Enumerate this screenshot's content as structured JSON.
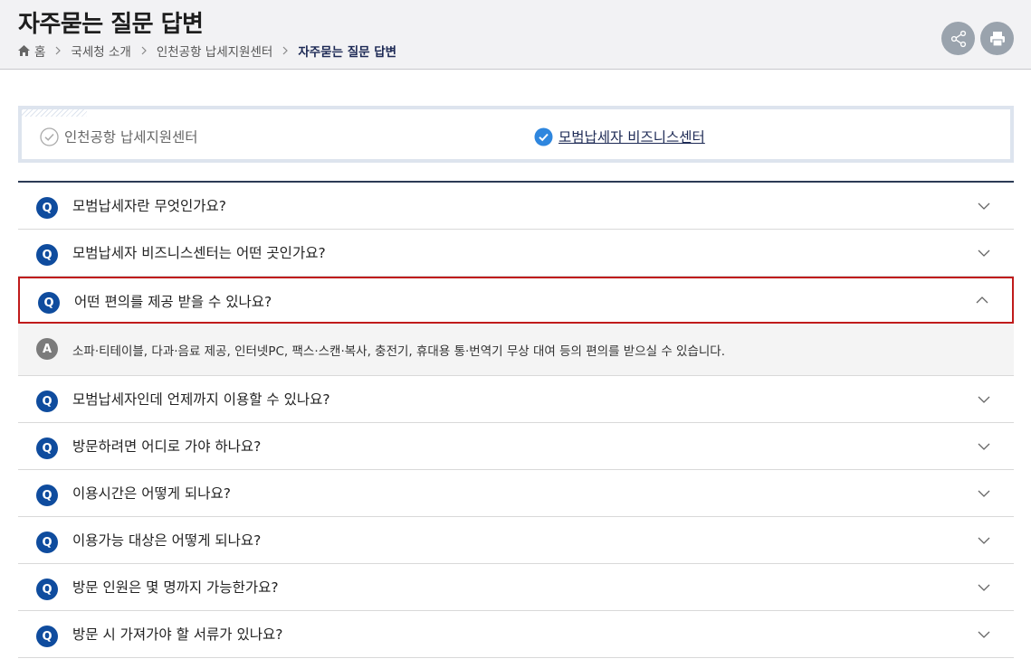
{
  "header": {
    "title": "자주묻는 질문 답변",
    "breadcrumb": [
      "홈",
      "국세청 소개",
      "인천공항 납세지원센터",
      "자주묻는 질문 답변"
    ],
    "share_icon": "share-icon",
    "print_icon": "print-icon"
  },
  "tabs": [
    {
      "label": "인천공항 납세지원센터",
      "selected": false
    },
    {
      "label": "모범납세자 비즈니스센터",
      "selected": true
    }
  ],
  "faq": {
    "q_badge": "Q",
    "a_badge": "A",
    "items": [
      {
        "question": "모범납세자란 무엇인가요?"
      },
      {
        "question": "모범납세자 비즈니스센터는 어떤 곳인가요?"
      },
      {
        "question": "어떤 편의를 제공 받을 수 있나요?",
        "open": true,
        "answer": "소파·티테이블, 다과·음료 제공, 인터넷PC, 팩스·스캔·복사, 충전기, 휴대용 통·번역기 무상 대여 등의 편의를 받으실 수 있습니다."
      },
      {
        "question": "모범납세자인데 언제까지 이용할 수 있나요?"
      },
      {
        "question": "방문하려면 어디로 가야 하나요?"
      },
      {
        "question": "이용시간은 어떻게 되나요?"
      },
      {
        "question": "이용가능 대상은 어떻게 되나요?"
      },
      {
        "question": "방문 인원은 몇 명까지 가능한가요?"
      },
      {
        "question": "방문 시 가져가야 할 서류가 있나요?"
      }
    ]
  },
  "colors": {
    "q_badge": "#0f4c9e",
    "a_badge": "#7b7b7b",
    "open_border": "#c01b1b",
    "check_selected": "#2e86de",
    "title_navy": "#1d2a55"
  }
}
